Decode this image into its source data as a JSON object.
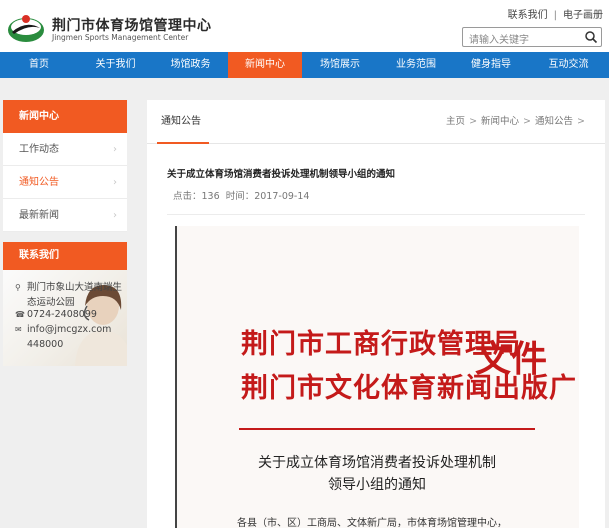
{
  "site": {
    "name_cn": "荆门市体育场馆管理中心",
    "name_en": "Jingmen Sports Management Center"
  },
  "top_links": {
    "contact": "联系我们",
    "brochure": "电子画册"
  },
  "search": {
    "placeholder": "请输入关键字"
  },
  "nav": {
    "items": [
      {
        "label": "首页"
      },
      {
        "label": "关于我们"
      },
      {
        "label": "场馆政务"
      },
      {
        "label": "新闻中心"
      },
      {
        "label": "场馆展示"
      },
      {
        "label": "业务范围"
      },
      {
        "label": "健身指导"
      },
      {
        "label": "互动交流"
      }
    ],
    "active_index": 3
  },
  "sidebar": {
    "title": "新闻中心",
    "items": [
      {
        "label": "工作动态",
        "chevron": "›"
      },
      {
        "label": "通知公告",
        "chevron": "›"
      },
      {
        "label": "最新新闻",
        "chevron": "›"
      }
    ],
    "current_index": 1
  },
  "contact": {
    "title": "联系我们",
    "address_line1": "荆门市象山大道南端生",
    "address_line2": "态运动公园",
    "phone": "0724-2408099",
    "email": "info@jmcgzx.com",
    "postcode": "448000",
    "icons": {
      "address": "location-pin-icon",
      "phone": "phone-icon",
      "email": "mail-icon"
    }
  },
  "main": {
    "tab_title": "通知公告",
    "breadcrumb": {
      "home": "主页",
      "section": "新闻中心",
      "current": "通知公告",
      "separator": ">"
    },
    "article": {
      "title": "关于成立体育场馆消费者投诉处理机制领导小组的通知",
      "clicks_label": "点击：",
      "clicks": "136",
      "time_label": "时间：",
      "time": "2017-09-14"
    }
  },
  "document": {
    "issuer_line1": "荆门市工商行政管理局",
    "issuer_line2": "荆门市文化体育新闻出版广电局",
    "doc_word": "文件",
    "heading_line1": "关于成立体育场馆消费者投诉处理机制",
    "heading_line2": "领导小组的通知",
    "body_first_line": "各县（市、区）工商局、文体新广局，市体育场馆管理中心，"
  },
  "colors": {
    "nav_blue": "#1976c7",
    "accent_orange": "#f15a22",
    "doc_red": "#c41a1a"
  }
}
